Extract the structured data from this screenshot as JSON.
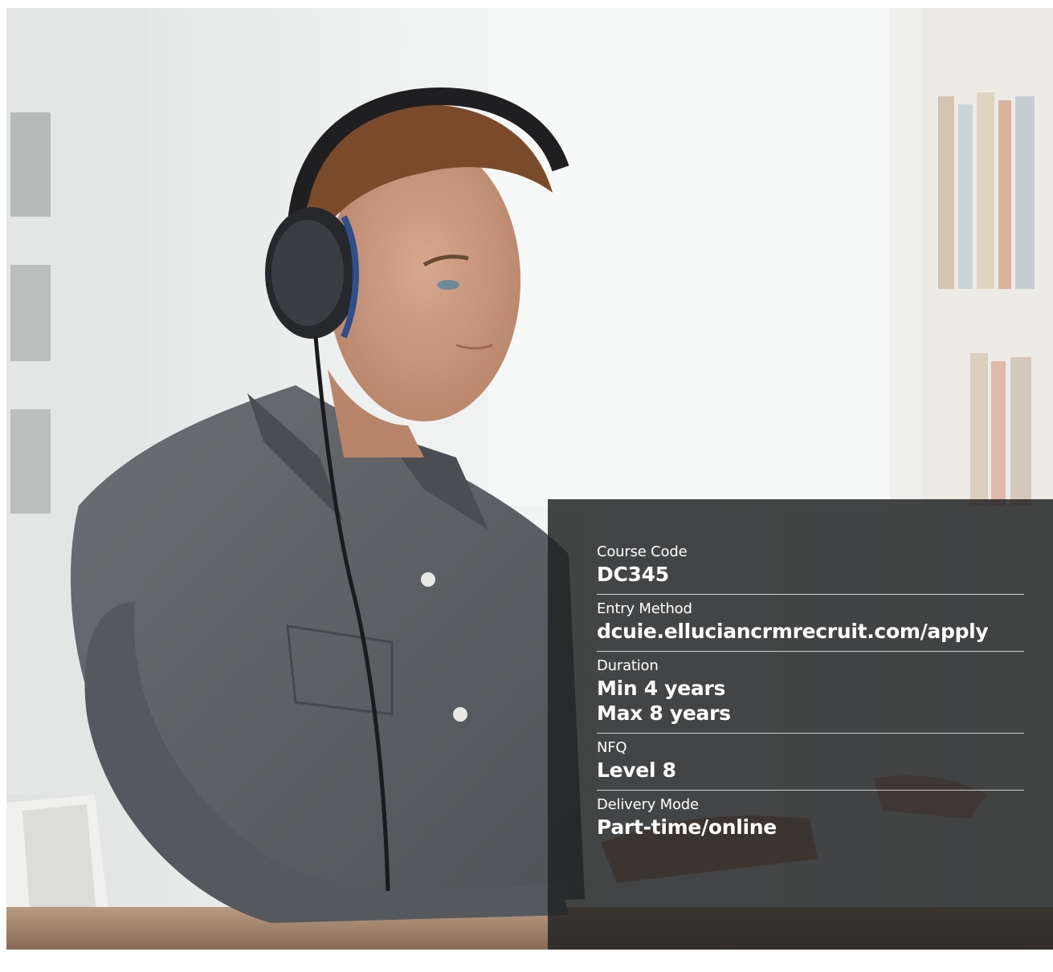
{
  "photo": {
    "subject": "man-with-headphones-at-laptop"
  },
  "info": {
    "items": [
      {
        "label": "Course Code",
        "values": [
          "DC345"
        ]
      },
      {
        "label": "Entry Method",
        "values": [
          "dcuie.elluciancrmrecruit.com/apply"
        ]
      },
      {
        "label": "Duration",
        "values": [
          "Min 4 years",
          "Max 8 years"
        ]
      },
      {
        "label": "NFQ",
        "values": [
          "Level 8"
        ]
      },
      {
        "label": "Delivery Mode",
        "values": [
          "Part-time/online"
        ]
      }
    ]
  },
  "colors": {
    "panel": "#202123",
    "text": "#ffffff",
    "shirt": "#5f6266",
    "skin": "#c9967a",
    "hair": "#7a4a2a"
  }
}
